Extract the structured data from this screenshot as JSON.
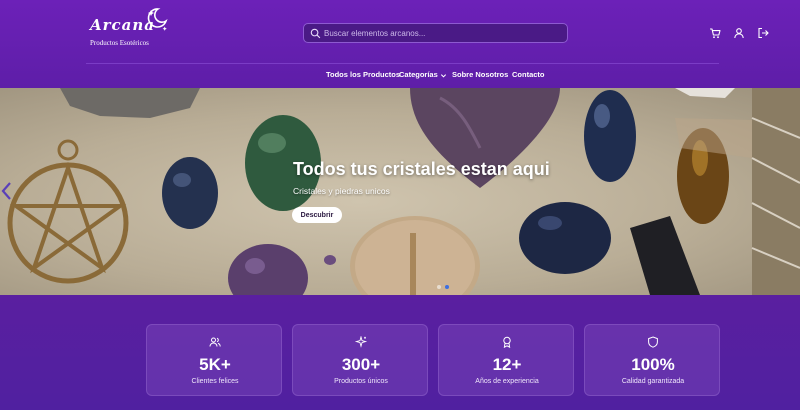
{
  "brand": {
    "name": "Arcana",
    "tagline": "Productos Esotéricos"
  },
  "search": {
    "placeholder": "Buscar elementos arcanos..."
  },
  "header_icons": [
    "cart-icon",
    "user-icon",
    "logout-icon"
  ],
  "nav": {
    "items": [
      {
        "label": "Todos los Productos"
      },
      {
        "label": "Categorías",
        "has_dropdown": true
      },
      {
        "label": "Sobre Nosotros"
      },
      {
        "label": "Contacto"
      }
    ]
  },
  "hero": {
    "title": "Todos tus cristales estan aqui",
    "subtitle": "Cristales y piedras unicos",
    "cta": "Descubrir",
    "slide_count": 2,
    "active_slide": 1
  },
  "stats": [
    {
      "icon": "users-icon",
      "value": "5K+",
      "label": "Clientes felices"
    },
    {
      "icon": "sparkles-icon",
      "value": "300+",
      "label": "Productos únicos"
    },
    {
      "icon": "award-icon",
      "value": "12+",
      "label": "Años de experiencia"
    },
    {
      "icon": "shield-icon",
      "value": "100%",
      "label": "Calidad garantizada"
    }
  ],
  "colors": {
    "header_bg": "#6c21b8",
    "page_bg": "#5a1f9e",
    "accent": "#8d5ad0"
  }
}
